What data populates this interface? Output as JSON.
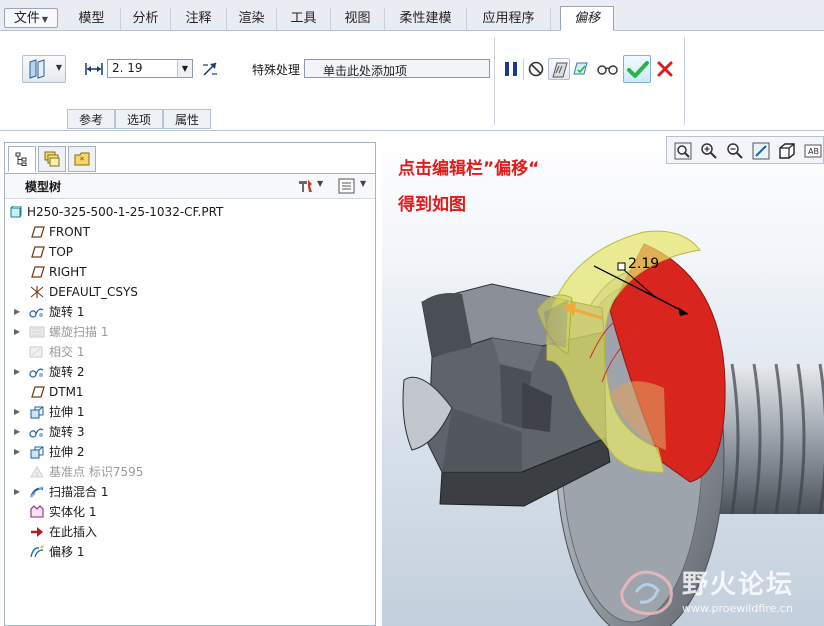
{
  "menu": {
    "file": "文件",
    "tabs": [
      "模型",
      "分析",
      "注释",
      "渲染",
      "工具",
      "视图",
      "柔性建模",
      "应用程序"
    ],
    "active_tab": "偏移"
  },
  "ribbon": {
    "distance_value": "2. 19",
    "special_label": "特殊处理",
    "special_placeholder": "单击此处添加项",
    "subtabs": [
      "参考",
      "选项",
      "属性"
    ]
  },
  "tree": {
    "header": "模型树",
    "root": "H250-325-500-1-25-1032-CF.PRT",
    "items": [
      {
        "label": "FRONT",
        "icon": "plane-icon",
        "expandable": false,
        "dim": false
      },
      {
        "label": "TOP",
        "icon": "plane-icon",
        "expandable": false,
        "dim": false
      },
      {
        "label": "RIGHT",
        "icon": "plane-icon",
        "expandable": false,
        "dim": false
      },
      {
        "label": "DEFAULT_CSYS",
        "icon": "csys-icon",
        "expandable": false,
        "dim": false
      },
      {
        "label": "旋转 1",
        "icon": "revolve-icon",
        "expandable": true,
        "dim": false
      },
      {
        "label": "螺旋扫描 1",
        "icon": "helical-sweep-icon",
        "expandable": true,
        "dim": true
      },
      {
        "label": "相交 1",
        "icon": "intersect-icon",
        "expandable": false,
        "dim": true
      },
      {
        "label": "旋转 2",
        "icon": "revolve-icon",
        "expandable": true,
        "dim": false
      },
      {
        "label": "DTM1",
        "icon": "plane-icon",
        "expandable": false,
        "dim": false
      },
      {
        "label": "拉伸 1",
        "icon": "extrude-icon",
        "expandable": true,
        "dim": false
      },
      {
        "label": "旋转 3",
        "icon": "revolve-icon",
        "expandable": true,
        "dim": false
      },
      {
        "label": "拉伸 2",
        "icon": "extrude-icon",
        "expandable": true,
        "dim": false
      },
      {
        "label": "基准点 标识7595",
        "icon": "datum-point-icon",
        "expandable": false,
        "dim": true
      },
      {
        "label": "扫描混合 1",
        "icon": "swept-blend-icon",
        "expandable": true,
        "dim": false
      },
      {
        "label": "实体化 1",
        "icon": "solidify-icon",
        "expandable": false,
        "dim": false
      },
      {
        "label": "在此插入",
        "icon": "insert-here-icon",
        "expandable": false,
        "dim": false
      },
      {
        "label": "偏移 1",
        "icon": "offset-icon",
        "expandable": false,
        "dim": false
      }
    ]
  },
  "graphics": {
    "annotation_line1": "点击编辑栏”偏移“",
    "annotation_line2": "得到如图",
    "dimension_label": "2.19",
    "watermark_title": "野火论坛",
    "watermark_url": "www.proewildfire.cn"
  },
  "colors": {
    "annotation": "#e21a1a",
    "accept": "#2bb34a",
    "cancel": "#d81e1e",
    "offset_surface": "#d8261f",
    "preview_surface": "#e6e66a"
  }
}
